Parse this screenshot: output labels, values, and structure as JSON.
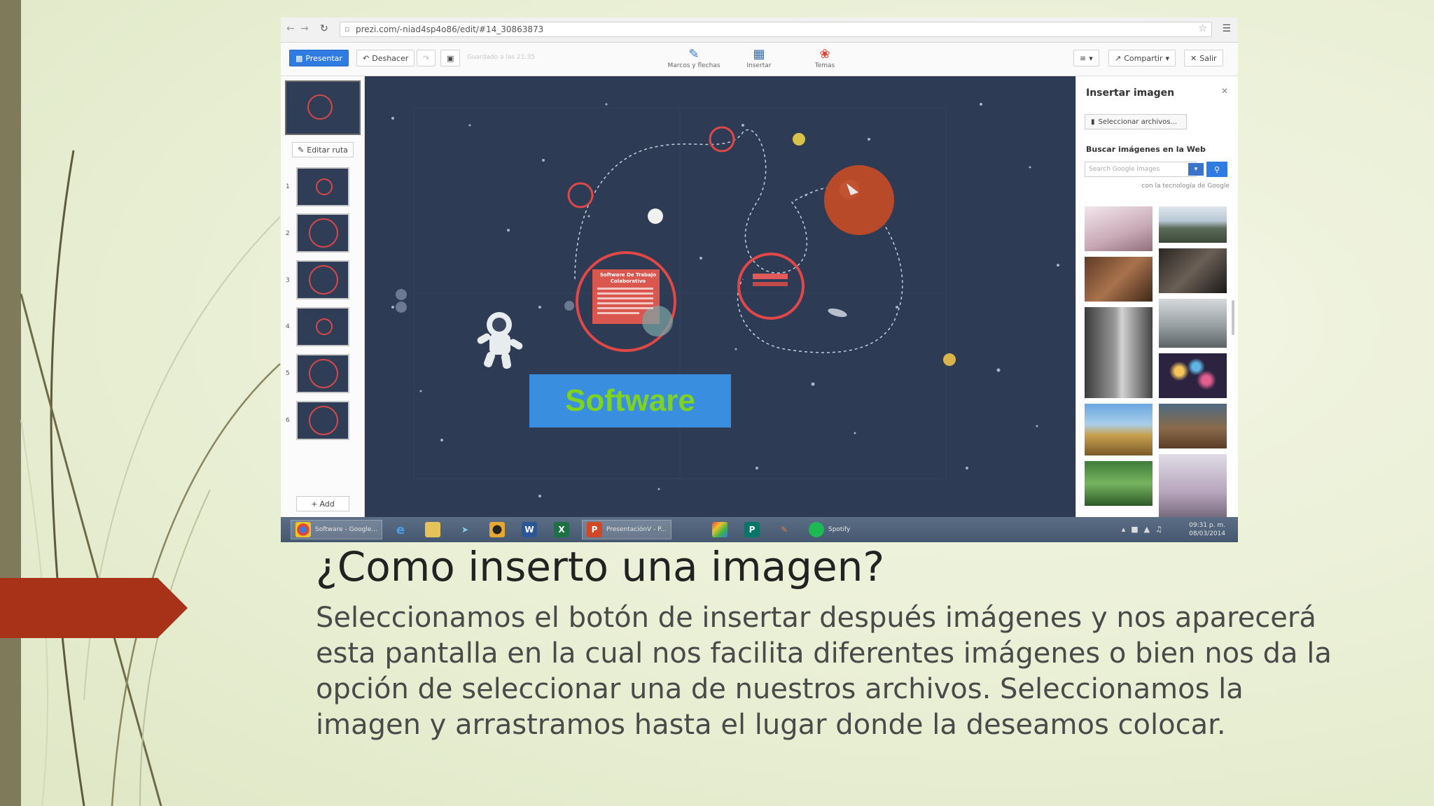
{
  "browser": {
    "url": "prezi.com/-niad4sp4o86/edit/#14_30863873"
  },
  "toolbar": {
    "present_label": "Presentar",
    "undo_label": "Deshacer",
    "saved_status": "Guardado a las 21:35",
    "frames_label": "Marcos y flechas",
    "insert_label": "Insertar",
    "themes_label": "Temas",
    "share_label": "Compartir",
    "exit_label": "Salir"
  },
  "thumbnails": {
    "edit_path_label": "Editar ruta",
    "add_label": "Add",
    "numbers": [
      "1",
      "2",
      "3",
      "4",
      "5",
      "6"
    ]
  },
  "canvas": {
    "software_label": "Software",
    "card_title": "Software De Trabajo Colaborativo"
  },
  "insert_panel": {
    "title": "Insertar imagen",
    "select_files_label": "Seleccionar archivos...",
    "search_web_label": "Buscar imágenes en la Web",
    "search_placeholder": "Search Google Images",
    "credit": "con la tecnología de Google"
  },
  "taskbar": {
    "chrome_label": "Software - Google...",
    "ppt_label": "PresentaciónV - P...",
    "spotify_label": "Spotify",
    "time": "09:31 p. m.",
    "date": "08/03/2014"
  },
  "slide": {
    "heading": "¿Como inserto una imagen?",
    "body": "Seleccionamos el botón de insertar después imágenes y nos aparecerá esta pantalla en la cual nos facilita diferentes imágenes o bien nos da la opción de seleccionar una de nuestros archivos. Seleccionamos la imagen y arrastramos hasta el lugar donde la deseamos colocar."
  },
  "colors": {
    "accent_arrow": "#a83218",
    "prezi_blue": "#2f7be1",
    "canvas_bg": "#2d3b55",
    "software_green": "#7ed321"
  }
}
